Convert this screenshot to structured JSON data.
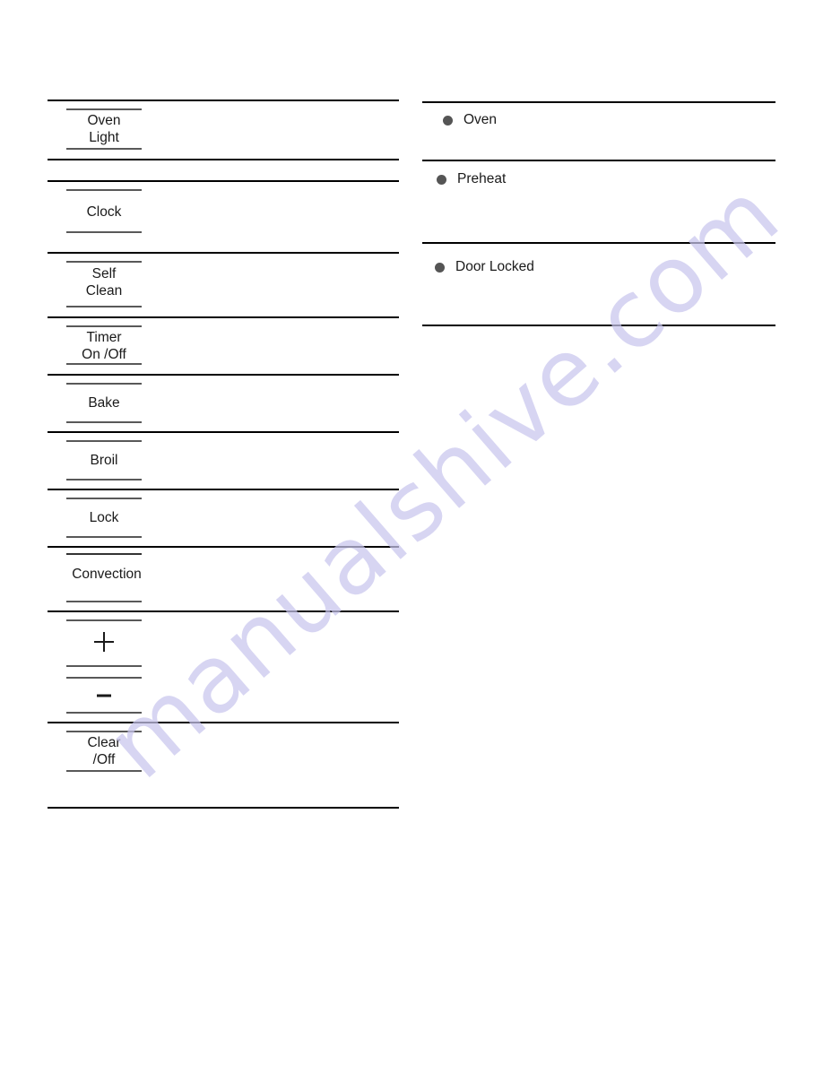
{
  "document": {
    "watermark_text": "manualshive.com",
    "watermark_color": "#c9c6ee",
    "page_background": "#ffffff",
    "rule_color": "#000000",
    "short_rule_color": "#595959",
    "indicator_dot_color": "#555555"
  },
  "control_panel": {
    "keys": [
      {
        "id": "oven-light",
        "label": "Oven\nLight",
        "type": "text",
        "top_rule": "single"
      },
      {
        "id": "clock",
        "label": "Clock",
        "type": "text",
        "top_rule": "single"
      },
      {
        "id": "self-clean",
        "label": "Self\nClean",
        "type": "text",
        "top_rule": "single"
      },
      {
        "id": "timer-onoff",
        "label": "Timer\nOn /Off",
        "type": "text",
        "top_rule": "single"
      },
      {
        "id": "bake",
        "label": "Bake",
        "type": "text",
        "top_rule": "single"
      },
      {
        "id": "broil",
        "label": "Broil",
        "type": "text",
        "top_rule": "single"
      },
      {
        "id": "lock",
        "label": "Lock",
        "type": "text",
        "top_rule": "single"
      },
      {
        "id": "convection",
        "label": "Convection",
        "type": "text",
        "top_rule": "double"
      },
      {
        "id": "plus",
        "label": "+",
        "type": "glyph",
        "top_rule": "single"
      },
      {
        "id": "minus",
        "label": "–",
        "type": "glyph",
        "top_rule": "single"
      },
      {
        "id": "clear-off",
        "label": "Clear\n/Off",
        "type": "text",
        "top_rule": "single"
      }
    ]
  },
  "indicators": {
    "items": [
      {
        "id": "oven",
        "label": "Oven"
      },
      {
        "id": "preheat",
        "label": "Preheat"
      },
      {
        "id": "door-locked",
        "label": "Door Locked"
      }
    ]
  }
}
